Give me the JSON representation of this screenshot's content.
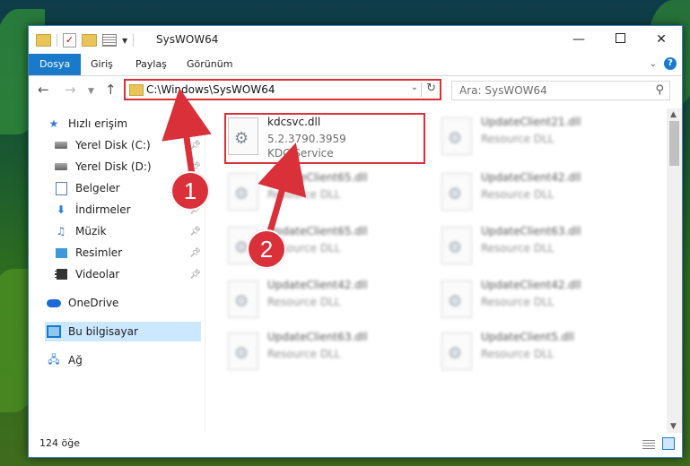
{
  "window": {
    "title": "SysWOW64"
  },
  "ribbon": {
    "tabs": [
      "Dosya",
      "Giriş",
      "Paylaş",
      "Görünüm"
    ],
    "help": "?"
  },
  "nav": {
    "address": "C:\\Windows\\SysWOW64",
    "search_placeholder": "Ara: SysWOW64"
  },
  "sidebar": {
    "items": [
      {
        "label": "Hızlı erişim",
        "icon": "star-icon",
        "pinned": false
      },
      {
        "label": "Yerel Disk (C:)",
        "icon": "drive-icon",
        "pinned": true
      },
      {
        "label": "Yerel Disk (D:)",
        "icon": "drive-icon",
        "pinned": true
      },
      {
        "label": "Belgeler",
        "icon": "document-icon",
        "pinned": true
      },
      {
        "label": "İndirmeler",
        "icon": "download-icon",
        "pinned": true
      },
      {
        "label": "Müzik",
        "icon": "music-icon",
        "pinned": true
      },
      {
        "label": "Resimler",
        "icon": "pictures-icon",
        "pinned": true
      },
      {
        "label": "Videolar",
        "icon": "video-icon",
        "pinned": true
      },
      {
        "label": "OneDrive",
        "icon": "cloud-icon",
        "pinned": false
      },
      {
        "label": "Bu bilgisayar",
        "icon": "computer-icon",
        "selected": true
      },
      {
        "label": "Ağ",
        "icon": "network-icon",
        "pinned": false
      }
    ]
  },
  "files": [
    {
      "name": "kdcsvc.dll",
      "line2": "5.2.3790.3959",
      "line3": "KDC Service",
      "highlight": true
    },
    {
      "name": "UpdateClient21.dll",
      "line2": "Resource DLL",
      "blurred": true
    },
    {
      "name": "UpdateClient65.dll",
      "line2": "Resource DLL",
      "blurred": true
    },
    {
      "name": "UpdateClient42.dll",
      "line2": "Resource DLL",
      "blurred": true
    },
    {
      "name": "UpdateClient65.dll",
      "line2": "Resource DLL",
      "blurred": true
    },
    {
      "name": "UpdateClient63.dll",
      "line2": "Resource DLL",
      "blurred": true
    },
    {
      "name": "UpdateClient42.dll",
      "line2": "Resource DLL",
      "blurred": true
    },
    {
      "name": "UpdateClient42.dll",
      "line2": "Resource DLL",
      "blurred": true
    },
    {
      "name": "UpdateClient63.dll",
      "line2": "Resource DLL",
      "blurred": true
    },
    {
      "name": "UpdateClient5.dll",
      "line2": "Resource DLL",
      "blurred": true
    }
  ],
  "status": {
    "count": "124 öğe"
  },
  "annotations": {
    "step1": "1",
    "step2": "2",
    "color": "#d9303a"
  }
}
